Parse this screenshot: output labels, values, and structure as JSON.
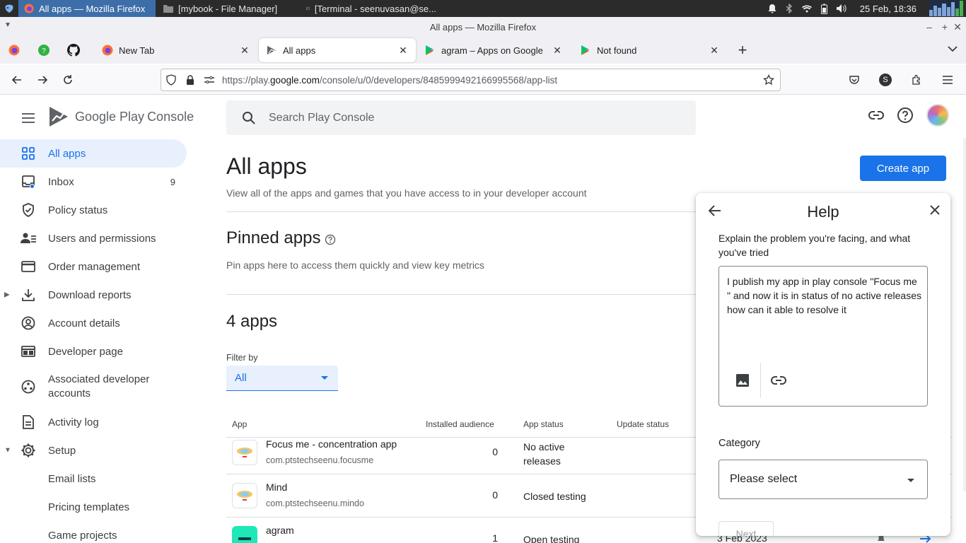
{
  "taskbar": {
    "tasks": [
      {
        "label": "All apps — Mozilla Firefox",
        "active": true
      },
      {
        "label": "[mybook - File Manager]",
        "active": false
      },
      {
        "label": "[Terminal - seenuvasan@se...",
        "active": false
      }
    ],
    "clock": "25 Feb, 18:36"
  },
  "window": {
    "title": "All apps — Mozilla Firefox"
  },
  "browser": {
    "tabs": [
      {
        "label": "New Tab"
      },
      {
        "label": "All apps"
      },
      {
        "label": "agram – Apps on Google Play"
      },
      {
        "label": "Not found"
      }
    ],
    "url_prefix": "https://play.",
    "url_host": "google.com",
    "url_path": "/console/u/0/developers/8485999492166995568/app-list",
    "profile_initial": "S"
  },
  "header": {
    "logo_google_play": "Google Play",
    "logo_console": "Console",
    "search_placeholder": "Search Play Console"
  },
  "sidebar": {
    "items": [
      {
        "label": "All apps",
        "icon": "grid-icon"
      },
      {
        "label": "Inbox",
        "icon": "inbox-icon",
        "badge": "9"
      },
      {
        "label": "Policy status",
        "icon": "shield-icon"
      },
      {
        "label": "Users and permissions",
        "icon": "users-icon"
      },
      {
        "label": "Order management",
        "icon": "credit-card-icon"
      },
      {
        "label": "Download reports",
        "icon": "download-icon"
      },
      {
        "label": "Account details",
        "icon": "account-icon"
      },
      {
        "label": "Developer page",
        "icon": "web-icon"
      },
      {
        "label": "Associated developer accounts",
        "icon": "linked-accounts-icon"
      },
      {
        "label": "Activity log",
        "icon": "log-icon"
      },
      {
        "label": "Setup",
        "icon": "gear-icon"
      },
      {
        "label": "Email lists"
      },
      {
        "label": "Pricing templates"
      },
      {
        "label": "Game projects"
      }
    ]
  },
  "main": {
    "title": "All apps",
    "subtitle": "View all of the apps and games that you have access to in your developer account",
    "create_label": "Create app",
    "pinned_title": "Pinned apps",
    "pinned_desc": "Pin apps here to access them quickly and view key metrics",
    "count_title": "4 apps",
    "filter_label": "Filter by",
    "filter_value": "All",
    "table": {
      "columns": [
        "App",
        "Installed audience",
        "App status",
        "Update status"
      ],
      "rows": [
        {
          "name": "Focus me - concentration app",
          "package": "com.ptstechseenu.focusme",
          "installs": "0",
          "status": "No active releases"
        },
        {
          "name": "Mind",
          "package": "com.ptstechseenu.mindo",
          "installs": "0",
          "status": "Closed testing"
        },
        {
          "name": "agram",
          "package": "",
          "installs": "1",
          "status": "Open testing",
          "last_update": "3 Feb 2023"
        }
      ]
    }
  },
  "help": {
    "title": "Help",
    "prompt": "Explain the problem you're facing, and what you've tried",
    "message": "I publish my app in play console \"Focus me \" and now it is in status of no active releases how can it able to resolve it",
    "category_label": "Category",
    "category_value": "Please select",
    "next_label": "Next"
  },
  "colors": {
    "accent": "#1a73e8",
    "active_bg": "#e8f0fe"
  }
}
